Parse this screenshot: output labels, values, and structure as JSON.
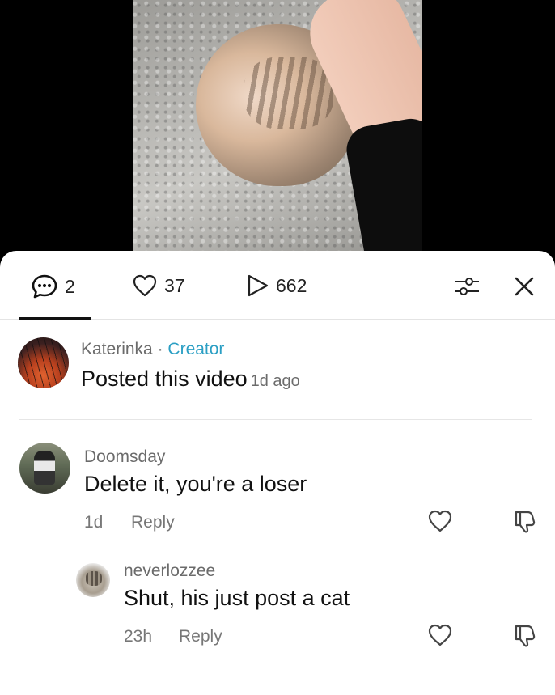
{
  "tabs": {
    "comments_count": "2",
    "likes_count": "37",
    "views_count": "662"
  },
  "icons": {
    "comments": "comment-bubble-icon",
    "likes": "heart-icon",
    "views": "play-icon",
    "filter": "sliders-icon",
    "close": "close-icon",
    "comment_like": "heart-icon",
    "comment_dislike": "thumbs-down-icon"
  },
  "caption": {
    "author": "Katerinka",
    "separator": "·",
    "badge": "Creator",
    "text": "Posted this video",
    "time": "1d ago"
  },
  "comments": [
    {
      "author": "Doomsday",
      "text": "Delete it, you're a loser",
      "time": "1d",
      "reply_label": "Reply"
    },
    {
      "author": "neverlozzee",
      "text": "Shut, his just post a cat",
      "time": "23h",
      "reply_label": "Reply"
    }
  ],
  "colors": {
    "creator_badge": "#2b9fc4",
    "text_primary": "#111111",
    "text_secondary": "#777777",
    "background": "#ffffff"
  }
}
